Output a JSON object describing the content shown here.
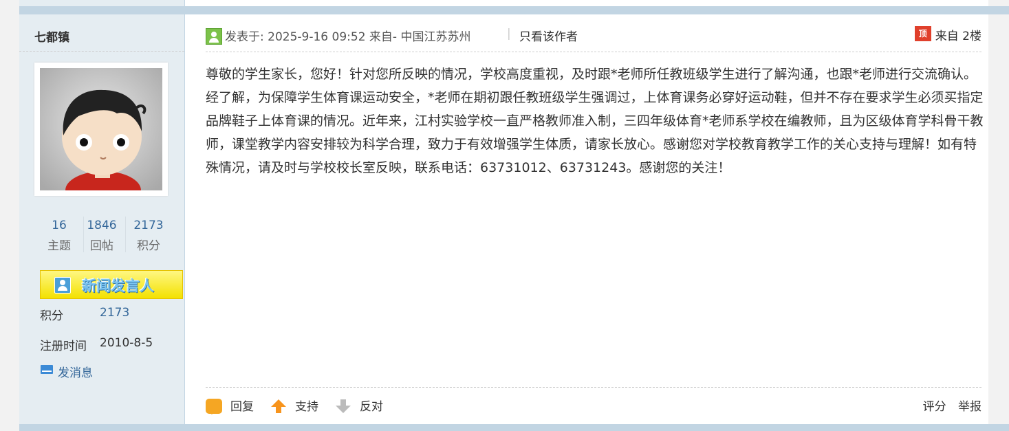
{
  "author": {
    "name": "七都镇",
    "stats": [
      {
        "value": "16",
        "label": "主题"
      },
      {
        "value": "1846",
        "label": "回帖"
      },
      {
        "value": "2173",
        "label": "积分"
      }
    ],
    "badge": "新闻发言人",
    "points_label": "积分",
    "points_value": "2173",
    "register_label": "注册时间",
    "register_value": "2010-8-5",
    "message_link": "发消息"
  },
  "post": {
    "meta": "发表于: 2025-9-16 09:52 来自- 中国江苏苏州",
    "pipe": "|",
    "only_author": "只看该作者",
    "top_icon_text": "顶",
    "floor": "来自 2楼",
    "body": "尊敬的学生家长，您好！针对您所反映的情况，学校高度重视，及时跟*老师所任教班级学生进行了解沟通，也跟*老师进行交流确认。经了解，为保障学生体育课运动安全，*老师在期初跟任教班级学生强调过，上体育课务必穿好运动鞋，但并不存在要求学生必须买指定品牌鞋子上体育课的情况。近年来，江村实验学校一直严格教师准入制，三四年级体育*老师系学校在编教师，且为区级体育学科骨干教师，课堂教学内容安排较为科学合理，致力于有效增强学生体质，请家长放心。感谢您对学校教育教学工作的关心支持与理解！如有特殊情况，请及时与学校校长室反映，联系电话：63731012、63731243。感谢您的关注！"
  },
  "actions": {
    "reply": "回复",
    "support": "支持",
    "oppose": "反对",
    "rate": "评分",
    "report": "举报"
  },
  "colors": {
    "sidebar_bg": "#e5edf2",
    "divider_bar": "#c2d5e3",
    "link_blue": "#336699",
    "badge_yellow": "#f3e100"
  }
}
